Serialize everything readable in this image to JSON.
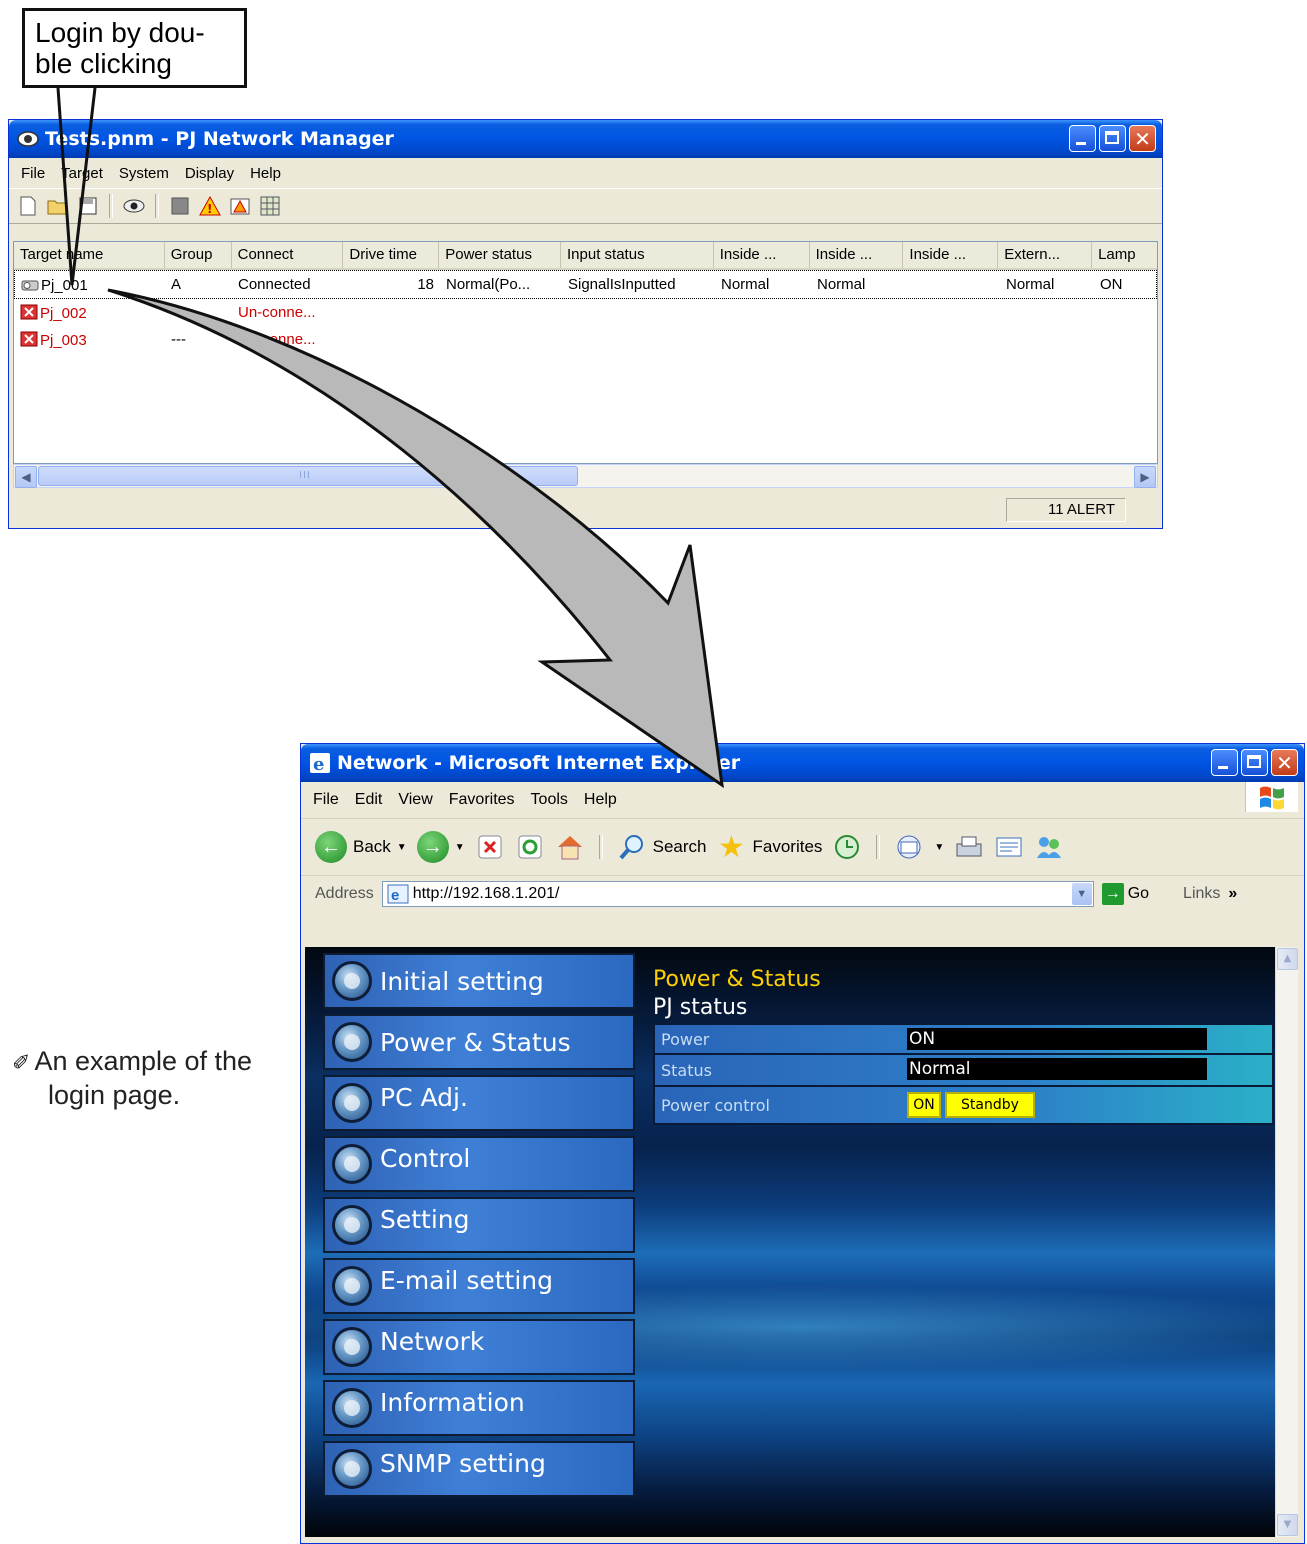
{
  "callout": {
    "line1": "Login by dou-",
    "line2": "ble clicking"
  },
  "pnm": {
    "title": "Tests.pnm - PJ Network Manager",
    "menu": [
      "File",
      "Target",
      "System",
      "Display",
      "Help"
    ],
    "columns": [
      "Target name",
      "Group",
      "Connect",
      "Drive time",
      "Power status",
      "Input status",
      "Inside ...",
      "Inside ...",
      "Inside ...",
      "Extern...",
      "Lamp"
    ],
    "rows": [
      {
        "name": "Pj_001",
        "group": "A",
        "connect": "Connected",
        "drive": "18",
        "power": "Normal(Po...",
        "input": "SignalIsInputted",
        "in1": "Normal",
        "in2": "Normal",
        "in3": "",
        "ext": "Normal",
        "lamp": "ON"
      },
      {
        "name": "Pj_002",
        "group": "",
        "connect": "Un-conne...",
        "drive": "",
        "power": "",
        "input": "",
        "in1": "",
        "in2": "",
        "in3": "",
        "ext": "",
        "lamp": ""
      },
      {
        "name": "Pj_003",
        "group": "---",
        "connect": "Un-conne...",
        "drive": "",
        "power": "",
        "input": "",
        "in1": "",
        "in2": "",
        "in3": "",
        "ext": "",
        "lamp": ""
      }
    ],
    "status": "11 ALERT",
    "icons": [
      "new-icon",
      "open-icon",
      "save-icon",
      "eye-icon",
      "stop-icon",
      "alert-icon",
      "alert-setting-icon",
      "grid-icon"
    ]
  },
  "ie": {
    "title": "Network - Microsoft Internet Explorer",
    "menu": [
      "File",
      "Edit",
      "View",
      "Favorites",
      "Tools",
      "Help"
    ],
    "toolbar": {
      "back": "Back",
      "search": "Search",
      "favorites": "Favorites"
    },
    "address": {
      "label": "Address",
      "url": "http://192.168.1.201/",
      "go": "Go",
      "links": "Links"
    },
    "nav": [
      "Initial setting",
      "Power & Status",
      "PC Adj.",
      "Control",
      "Setting",
      "E-mail setting",
      "Network",
      "Information",
      "SNMP setting"
    ],
    "panel": {
      "title": "Power & Status",
      "subtitle": "PJ status",
      "power_label": "Power",
      "power_value": "ON",
      "status_label": "Status",
      "status_value": "Normal",
      "control_label": "Power control",
      "btn_on": "ON",
      "btn_standby": "Standby"
    }
  },
  "note": {
    "line1": "An example of the",
    "line2": "login page."
  }
}
